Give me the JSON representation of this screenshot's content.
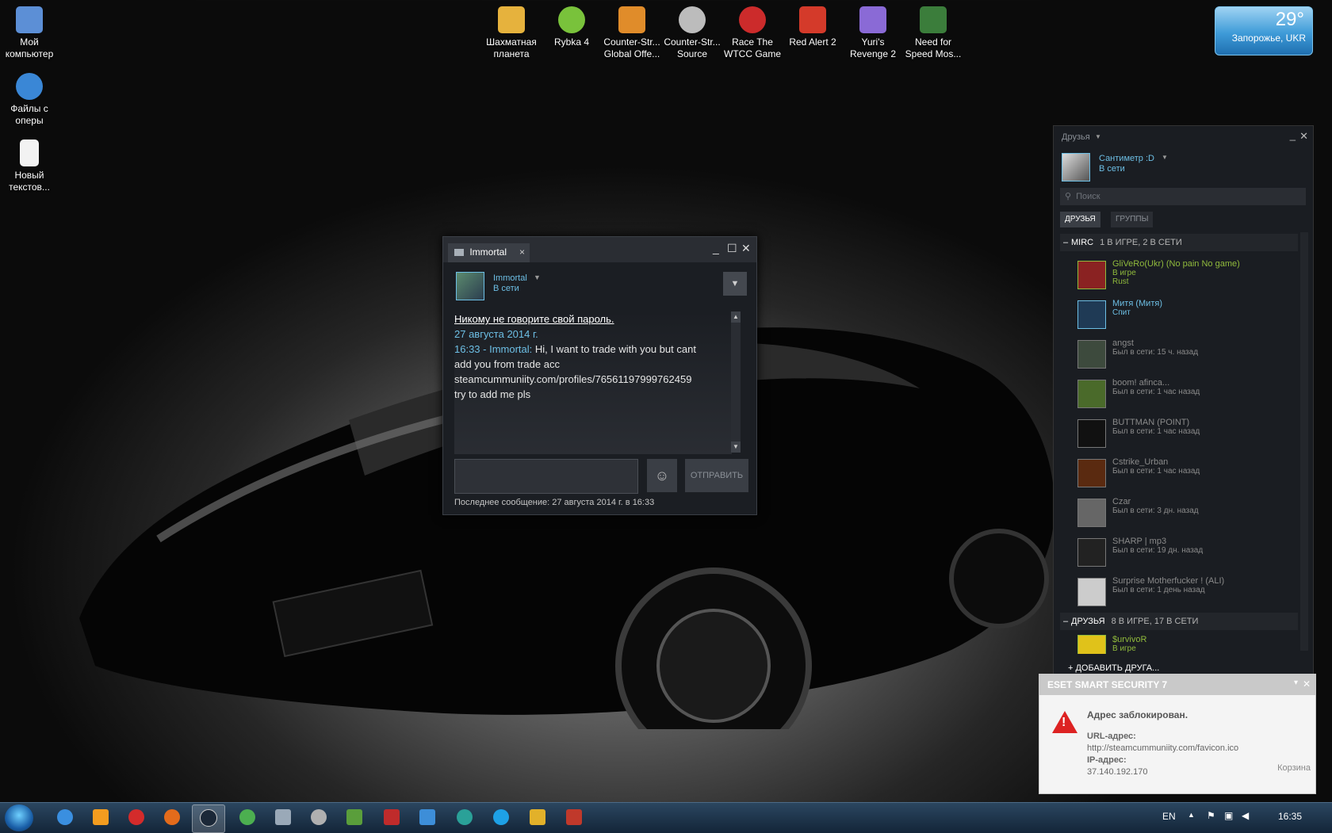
{
  "desktop": {
    "left_icons": [
      {
        "label_1": "Мой",
        "label_2": "компьютер",
        "icon": "computer-icon",
        "color": "#5c8fd6"
      },
      {
        "label_1": "Файлы с",
        "label_2": "оперы",
        "icon": "ie-folder-icon",
        "color": "#3a87d6"
      },
      {
        "label_1": "Новый",
        "label_2": "текстов...",
        "icon": "text-file-icon",
        "color": "#f2f2f2"
      }
    ],
    "top_icons": [
      {
        "label_1": "Шахматная",
        "label_2": "планета",
        "icon": "chess-icon",
        "color": "#e6b23d"
      },
      {
        "label_1": "Rybka 4",
        "label_2": "",
        "icon": "fish-icon",
        "color": "#79c23b"
      },
      {
        "label_1": "Counter-Str...",
        "label_2": "Global Offe...",
        "icon": "csgo-icon",
        "color": "#e08c2a"
      },
      {
        "label_1": "Counter-Str...",
        "label_2": "Source",
        "icon": "css-icon",
        "color": "#bcbcbc"
      },
      {
        "label_1": "Race The",
        "label_2": "WTCC Game",
        "icon": "race-icon",
        "color": "#cc2b2b"
      },
      {
        "label_1": "Red Alert 2",
        "label_2": "",
        "icon": "red-alert-icon",
        "color": "#d43a2a"
      },
      {
        "label_1": "Yuri's",
        "label_2": "Revenge 2",
        "icon": "yuri-icon",
        "color": "#8a6ad6"
      },
      {
        "label_1": "Need for",
        "label_2": "Speed Mos...",
        "icon": "nfs-icon",
        "color": "#3b7d3b"
      }
    ]
  },
  "weather": {
    "temp": "29°",
    "city": "Запорожье, UKR"
  },
  "chat": {
    "tab_title": "Immortal",
    "close": "×",
    "friend_name": "Immortal",
    "friend_status": "В сети",
    "warning": "Никому не говорите свой пароль.",
    "date": "27 августа 2014 г.",
    "msg_prefix": "16:33 - Immortal:",
    "msg_lines": [
      "Hi, I want to trade with you but cant",
      "add you from trade acc",
      "steamcummuniity.com/profiles/76561197999762459",
      "try to add me pls"
    ],
    "msg_line_1": " Hi, I want to trade with you but cant",
    "send_label": "ОТПРАВИТЬ",
    "last_message": "Последнее сообщение: 27 августа 2014 г. в 16:33"
  },
  "friends": {
    "title": "Друзья",
    "me_name": "Сантиметр :D",
    "me_status": "В сети",
    "search_placeholder": "Поиск",
    "tabs": [
      "ДРУЗЬЯ",
      "ГРУППЫ"
    ],
    "group1": {
      "title": "MIRC",
      "count": "1 В ИГРЕ, 2 В СЕТИ"
    },
    "list": [
      {
        "name": "GliVeRo(Ukr) (No pain No game)",
        "status": "В игре",
        "game": "Rust",
        "color": "#90ba3c"
      },
      {
        "name": "Митя (Митя)",
        "status": "Спит",
        "game": "",
        "color": "#6dbfe5"
      },
      {
        "name": "angst",
        "status": "Был в сети: 15 ч. назад",
        "game": "",
        "color": "#8a8a8a"
      },
      {
        "name": "boom! afinca...",
        "status": "Был в сети: 1 час назад",
        "game": "",
        "color": "#8a8a8a"
      },
      {
        "name": "BUTTMAN (POINT)",
        "status": "Был в сети: 1 час назад",
        "game": "",
        "color": "#8a8a8a"
      },
      {
        "name": "Cstrike_Urban",
        "status": "Был в сети: 1 час назад",
        "game": "",
        "color": "#8a8a8a"
      },
      {
        "name": "Czar",
        "status": "Был в сети: 3 дн. назад",
        "game": "",
        "color": "#8a8a8a"
      },
      {
        "name": "SHARP | mp3",
        "status": "Был в сети: 19 дн. назад",
        "game": "",
        "color": "#8a8a8a"
      },
      {
        "name": "Surprise Motherfucker ! (ALI)",
        "status": "Был в сети: 1 день назад",
        "game": "",
        "color": "#8a8a8a"
      }
    ],
    "group2": {
      "title": "ДРУЗЬЯ",
      "count": "8 В ИГРЕ, 17 В СЕТИ"
    },
    "last_item": {
      "name": "$urvivoR",
      "status": "В игре"
    },
    "add_friend": "ДОБАВИТЬ ДРУГА..."
  },
  "eset": {
    "brand": "ESET SMART SECURITY 7",
    "title": "Адрес заблокирован.",
    "url_label": "URL-адрес:",
    "url": "http://steamcummuniity.com/favicon.ico",
    "ip_label": "IP-адрес:",
    "ip": "37.140.192.170",
    "recycle": "Корзина"
  },
  "taskbar": {
    "lang": "EN",
    "time": "16:35",
    "icons": [
      {
        "name": "ie-taskbar-icon",
        "color": "#3a8fe0"
      },
      {
        "name": "media-player-icon",
        "color": "#f39c1f"
      },
      {
        "name": "opera-icon",
        "color": "#d42b2b"
      },
      {
        "name": "firefox-icon",
        "color": "#e36b1b"
      },
      {
        "name": "steam-taskbar-icon",
        "color": "#1b2838"
      },
      {
        "name": "chrome-icon",
        "color": "#4caf50"
      },
      {
        "name": "app-icon-6",
        "color": "#9aa9b8"
      },
      {
        "name": "app-icon-7",
        "color": "#b0b0b0"
      },
      {
        "name": "app-icon-8",
        "color": "#5a9e3b"
      },
      {
        "name": "filezilla-icon",
        "color": "#bf2b2b"
      },
      {
        "name": "app-icon-10",
        "color": "#3d8ed8"
      },
      {
        "name": "eset-icon",
        "color": "#2aa198"
      },
      {
        "name": "skype-icon",
        "color": "#1ea1e6"
      },
      {
        "name": "app-icon-13",
        "color": "#e2b12a"
      },
      {
        "name": "app-icon-14",
        "color": "#c0392b"
      }
    ]
  }
}
